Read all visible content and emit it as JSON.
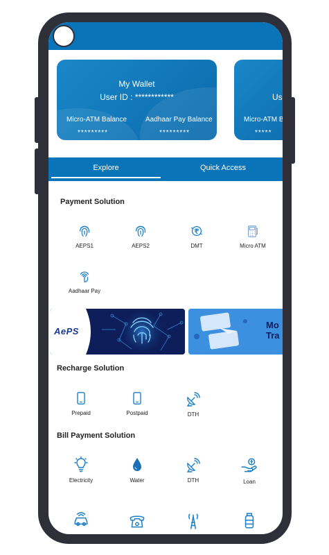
{
  "wallet_cards": [
    {
      "title": "My Wallet",
      "user_id": "User ID : ************",
      "micro_atm_label": "Micro-ATM Balance",
      "micro_atm_value": "*********",
      "aadhaar_label": "Aadhaar Pay Balance",
      "aadhaar_value": "*********"
    },
    {
      "user_id_partial": "Us",
      "micro_atm_label_partial": "Micro-ATM B",
      "micro_atm_value_partial": "*****"
    }
  ],
  "tabs": [
    "Explore",
    "Quick Access"
  ],
  "payment_solution": {
    "title": "Payment Solution",
    "items": [
      {
        "label": "AEPS1",
        "icon": "fingerprint-icon"
      },
      {
        "label": "AEPS2",
        "icon": "fingerprint-icon"
      },
      {
        "label": "DMT",
        "icon": "rupee-transfer-icon"
      },
      {
        "label": "Micro ATM",
        "icon": "micro-atm-icon"
      },
      {
        "label": "Aadhaar Pay",
        "icon": "fingerprint-touch-icon"
      }
    ]
  },
  "banners": {
    "aeps_logo": "AePS",
    "money_transfer_partial_line1": "Mo",
    "money_transfer_partial_line2": "Tra"
  },
  "recharge_solution": {
    "title": "Recharge Solution",
    "items": [
      {
        "label": "Prepaid",
        "icon": "mobile-icon"
      },
      {
        "label": "Postpaid",
        "icon": "mobile-icon"
      },
      {
        "label": "DTH",
        "icon": "satellite-dish-icon"
      }
    ]
  },
  "bill_payment_solution": {
    "title": "Bill Payment Solution",
    "items": [
      {
        "label": "Electricity",
        "icon": "bulb-icon"
      },
      {
        "label": "Water",
        "icon": "water-drop-icon"
      },
      {
        "label": "DTH",
        "icon": "satellite-dish-icon"
      },
      {
        "label": "Loan",
        "icon": "loan-hand-icon"
      }
    ],
    "more_icons": [
      "car-insurance-icon",
      "telephone-icon",
      "tower-icon",
      "gas-cylinder-icon"
    ]
  },
  "colors": {
    "brand_blue": "#0a74b8",
    "icon_blue": "#1a7fc4",
    "phone_frame": "#2f2f3a"
  }
}
